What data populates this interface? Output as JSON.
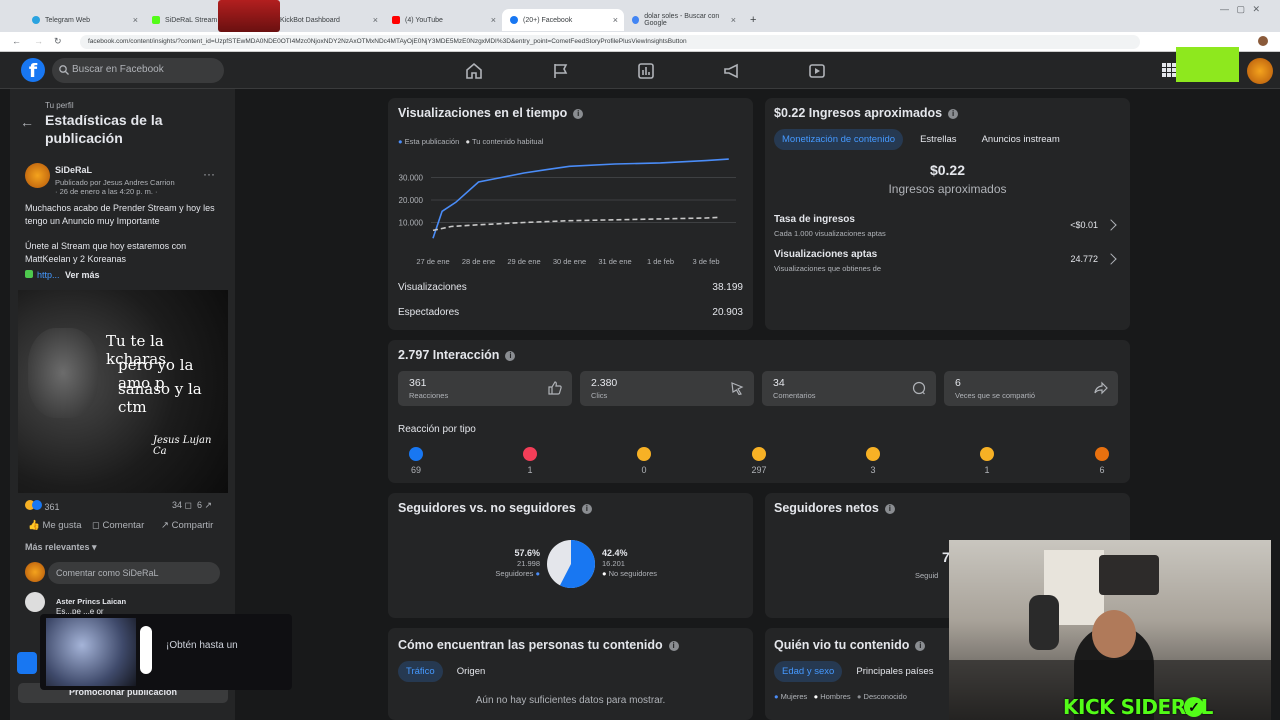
{
  "browser": {
    "tabs": [
      {
        "label": "Telegram Web",
        "color": "#2aa3e0"
      },
      {
        "label": "SiDeRaL Stream - K",
        "color": "#53fc18"
      },
      {
        "label": "KickBot Dashboard",
        "color": "#888888"
      },
      {
        "label": "(4) YouTube",
        "color": "#ff0000"
      },
      {
        "label": "(20+) Facebook",
        "color": "#1877f2"
      },
      {
        "label": "dolar soles - Buscar con Google",
        "color": "#4285f4"
      }
    ],
    "url": "facebook.com/content/insights/?content_id=UzpfSTEwMDA0NDE0OTI4Mzc0NjoxNDY2NzAxOTMxNDc4MTAyOjE0NjY3MDE5MzE0NzgxMDI%3D&entry_point=CometFeedStoryProfilePlusViewInsightsButton"
  },
  "fb": {
    "search_placeholder": "Buscar en Facebook"
  },
  "left": {
    "overline": "Tu perfil",
    "title": "Estadísticas de la publicación",
    "author": "SiDeRaL",
    "published_by": "Publicado por Jesus Andres Carrion",
    "date": "· 26 de enero a las 4:20 p. m. ·",
    "post_line1": "Muchachos acabo de Prender Stream y hoy les tengo un Anuncio muy Importante",
    "post_line2": "Únete al Stream que hoy estaremos con MattKeelan y 2 Koreanas",
    "link": "http...",
    "see_more": "Ver más",
    "image_text1": "Tu te la kcharas,",
    "image_text2": "pero yo la amo p",
    "image_text3": "sanaso y la ctm",
    "image_sig": "Jesus Lujan Ca",
    "reactions": "361",
    "comments": "34",
    "shares": "6",
    "like": "Me gusta",
    "comment": "Comentar",
    "share": "Compartir",
    "most_relevant": "Más relevantes",
    "comment_placeholder": "Comentar como SiDeRaL",
    "commenter": "Aster Princs Laican",
    "comment_text": "Es...pe ...e or",
    "ad_text": "¡Obtén hasta un",
    "promote": "Promocionar publicación"
  },
  "views": {
    "title": "Visualizaciones en el tiempo",
    "legend_a": "Esta publicación",
    "legend_b": "Tu contenido habitual",
    "views_label": "Visualizaciones",
    "views_value": "38.199",
    "viewers_label": "Espectadores",
    "viewers_value": "20.903"
  },
  "chart_data": {
    "type": "line",
    "x": [
      "27 de ene",
      "28 de ene",
      "29 de ene",
      "30 de ene",
      "31 de ene",
      "1 de feb",
      "3 de feb"
    ],
    "yticks": [
      "30.000",
      "20.000",
      "10.000"
    ],
    "ylim": [
      0,
      40000
    ],
    "series": [
      {
        "name": "Esta publicación",
        "color": "#4a8cf7",
        "points": [
          [
            0,
            3000
          ],
          [
            0.2,
            15000
          ],
          [
            0.5,
            19000
          ],
          [
            1,
            28000
          ],
          [
            1.5,
            30000
          ],
          [
            2,
            32000
          ],
          [
            2.5,
            33500
          ],
          [
            3,
            35000
          ],
          [
            4,
            36000
          ],
          [
            5,
            36500
          ],
          [
            6,
            37500
          ],
          [
            6.5,
            38199
          ]
        ]
      },
      {
        "name": "Tu contenido habitual",
        "color": "#c8c8c8",
        "points": [
          [
            0,
            6500
          ],
          [
            0.4,
            8200
          ],
          [
            1,
            9000
          ],
          [
            2,
            10000
          ],
          [
            3,
            10800
          ],
          [
            4,
            11200
          ],
          [
            5,
            11600
          ],
          [
            6,
            12000
          ],
          [
            6.3,
            12300
          ]
        ]
      }
    ]
  },
  "income": {
    "title": "$0.22 Ingresos aproximados",
    "tabs": [
      "Monetización de contenido",
      "Estrellas",
      "Anuncios instream"
    ],
    "big_value": "$0.22",
    "big_label": "Ingresos aproximados",
    "rate_label": "Tasa de ingresos",
    "rate_sub": "Cada 1.000 visualizaciones aptas",
    "rate_value": "<$0.01",
    "eligible_label": "Visualizaciones aptas",
    "eligible_sub": "Visualizaciones que obtienes de",
    "eligible_value": "24.772"
  },
  "interaction": {
    "title": "2.797 Interacción",
    "tiles": [
      {
        "value": "361",
        "label": "Reacciones"
      },
      {
        "value": "2.380",
        "label": "Clics"
      },
      {
        "value": "34",
        "label": "Comentarios"
      },
      {
        "value": "6",
        "label": "Veces que se compartió"
      }
    ],
    "by_type": "Reacción por tipo",
    "reactions": [
      {
        "name": "like",
        "count": "69",
        "color": "#1877f2"
      },
      {
        "name": "love",
        "count": "1",
        "color": "#f33e58"
      },
      {
        "name": "care",
        "count": "0",
        "color": "#f7b125"
      },
      {
        "name": "haha",
        "count": "297",
        "color": "#f7b125"
      },
      {
        "name": "wow",
        "count": "3",
        "color": "#f7b125"
      },
      {
        "name": "sad",
        "count": "1",
        "color": "#f7b125"
      },
      {
        "name": "angry",
        "count": "6",
        "color": "#e9710f"
      }
    ]
  },
  "followers": {
    "title": "Seguidores vs. no seguidores",
    "followers_pct": "57.6%",
    "followers_count": "21.998",
    "followers_label": "Seguidores",
    "non_pct": "42.4%",
    "non_count": "16.201",
    "non_label": "No seguidores",
    "followers_fraction": 0.576,
    "net_title": "Seguidores netos",
    "net_partial": "7",
    "net_sub": "Seguid"
  },
  "discover": {
    "title": "Cómo encuentran las personas tu contenido",
    "tabs": [
      "Tráfico",
      "Origen"
    ],
    "empty": "Aún no hay suficientes datos para mostrar."
  },
  "audience": {
    "title": "Quién vio tu contenido",
    "tabs": [
      "Edad y sexo",
      "Principales países"
    ],
    "legend": [
      "Mujeres",
      "Hombres",
      "Desconocido"
    ]
  },
  "stream": {
    "brand": "KICK SIDERAL"
  }
}
